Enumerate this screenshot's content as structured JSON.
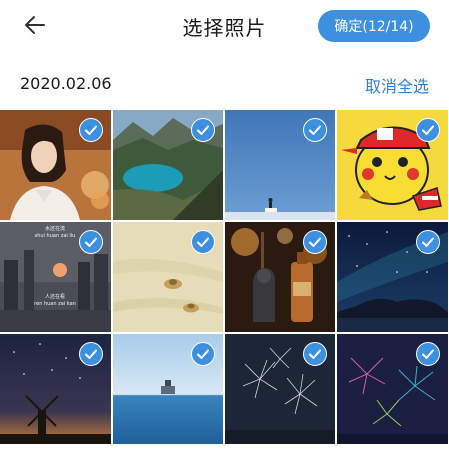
{
  "header": {
    "title": "选择照片",
    "confirm_label": "确定(12/14)"
  },
  "section": {
    "date": "2020.02.06",
    "deselect_all": "取消全选"
  },
  "photos": [
    {
      "name": "photo-girl-portrait",
      "selected": true
    },
    {
      "name": "photo-mountain-lake",
      "selected": true
    },
    {
      "name": "photo-blue-sky-figure",
      "selected": true
    },
    {
      "name": "photo-pikachu",
      "selected": true
    },
    {
      "name": "photo-city-moon-night",
      "selected": true,
      "caption_line1": "水还在流",
      "caption_line2": "shui huan zai liu",
      "caption_line3": "人还在看",
      "caption_line4": "ren huan zai kan"
    },
    {
      "name": "photo-beach-hats",
      "selected": true
    },
    {
      "name": "photo-bottles-figurines",
      "selected": true
    },
    {
      "name": "photo-starry-coast",
      "selected": true
    },
    {
      "name": "photo-windmill-stars",
      "selected": true
    },
    {
      "name": "photo-sea-ship",
      "selected": true
    },
    {
      "name": "photo-fireworks-white",
      "selected": true
    },
    {
      "name": "photo-fireworks-color",
      "selected": true
    }
  ],
  "colors": {
    "accent": "#3d8fe0",
    "link": "#2f7fd6"
  },
  "icons": {
    "back": "arrow-left-icon",
    "check": "checkmark-icon"
  }
}
